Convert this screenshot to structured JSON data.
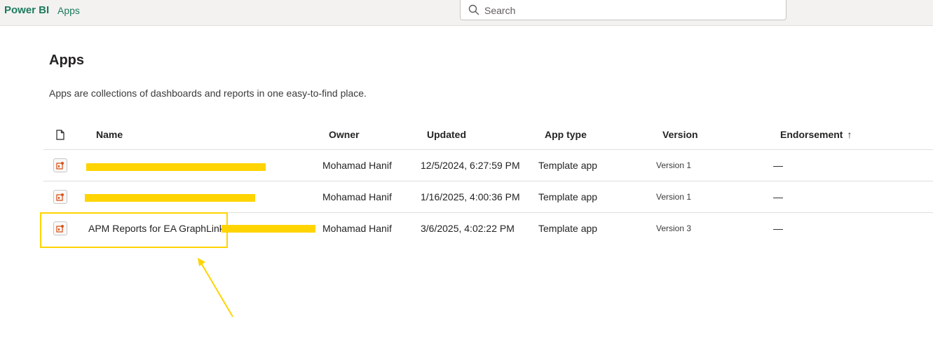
{
  "header": {
    "brand": "Power BI",
    "breadcrumb": "Apps",
    "search": {
      "placeholder": "Search",
      "icon": "search-icon"
    }
  },
  "page": {
    "title": "Apps",
    "description": "Apps are collections of dashboards and reports in one easy-to-find place."
  },
  "table": {
    "columns": {
      "type_icon": "document-icon",
      "name": "Name",
      "owner": "Owner",
      "updated": "Updated",
      "app_type": "App type",
      "version": "Version",
      "endorsement": "Endorsement",
      "sort_indicator": "↑"
    },
    "rows": [
      {
        "name": "",
        "owner": "Mohamad Hanif",
        "updated": "12/5/2024, 6:27:59 PM",
        "app_type": "Template app",
        "version": "Version 1",
        "endorsement": "—"
      },
      {
        "name": "",
        "owner": "Mohamad Hanif",
        "updated": "1/16/2025, 4:00:36 PM",
        "app_type": "Template app",
        "version": "Version 1",
        "endorsement": "—"
      },
      {
        "name": "APM Reports for EA GraphLink",
        "owner": "Mohamad Hanif",
        "updated": "3/6/2025, 4:02:22 PM",
        "app_type": "Template app",
        "version": "Version 3",
        "endorsement": "—"
      }
    ]
  },
  "colors": {
    "brand": "#1e7a5e",
    "highlight": "#ffd400",
    "app_icon": "#d9541e"
  }
}
